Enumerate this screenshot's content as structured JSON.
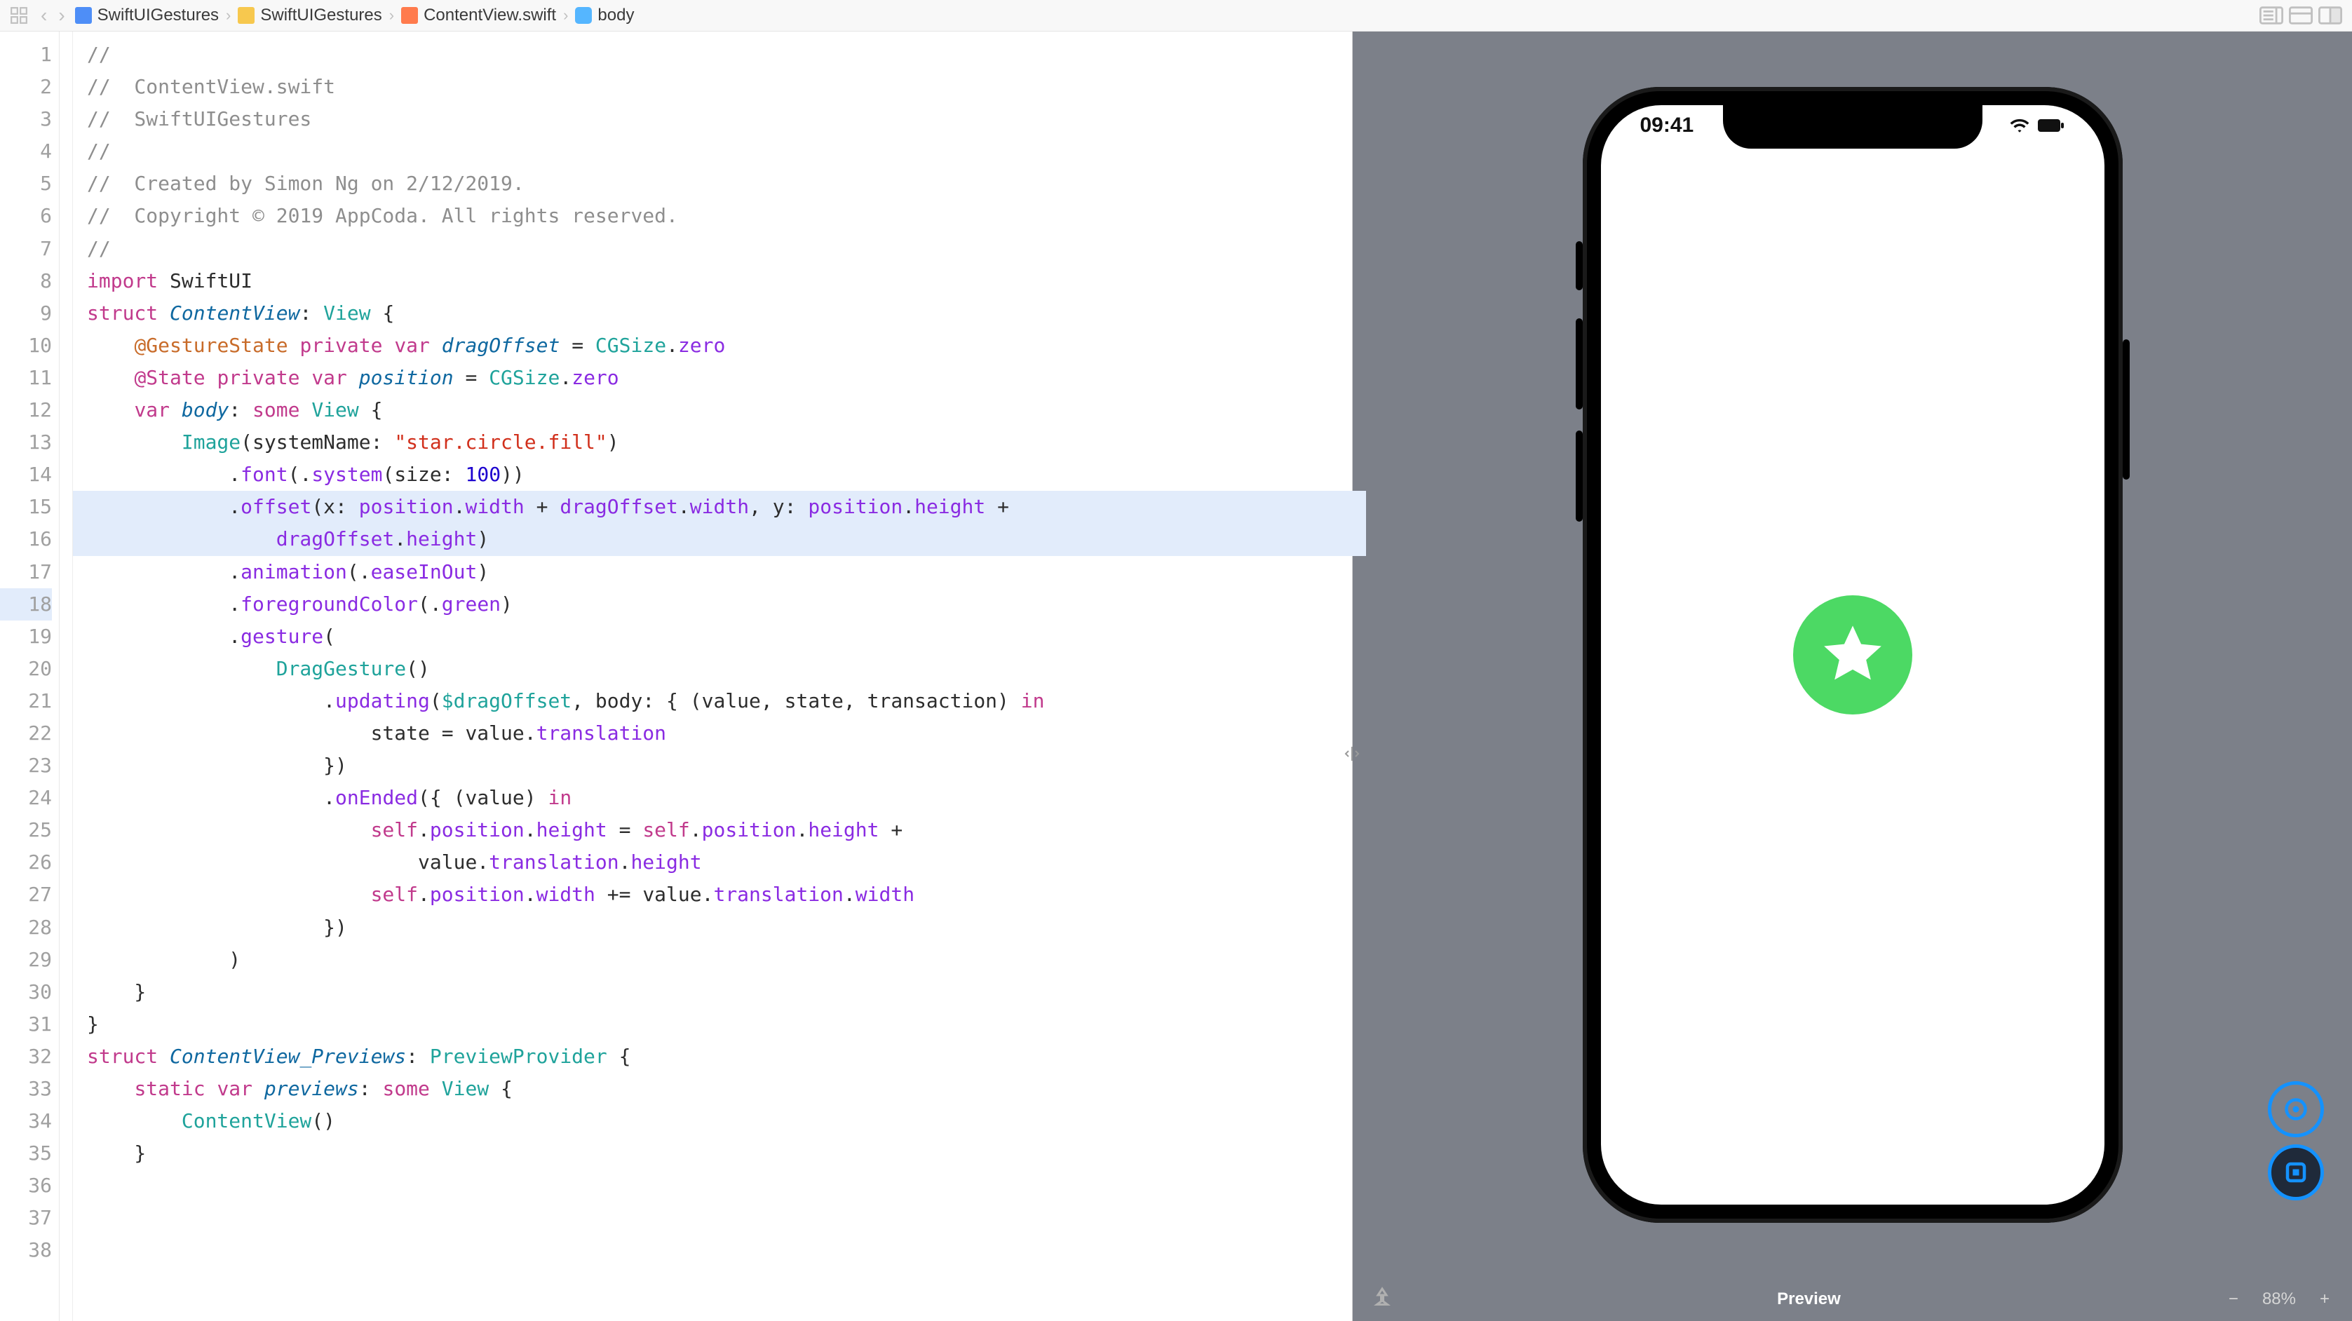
{
  "breadcrumb": {
    "project": "SwiftUIGestures",
    "group": "SwiftUIGestures",
    "file": "ContentView.swift",
    "symbol": "body"
  },
  "status_bar": {
    "time": "09:41",
    "wifi": "wifi",
    "battery": "battery-full"
  },
  "preview": {
    "label": "Preview",
    "zoom": "88%",
    "pinned": false
  },
  "code": {
    "highlighted_line": 18,
    "lines": [
      {
        "n": 1,
        "t": [
          {
            "s": "com",
            "x": "//"
          }
        ]
      },
      {
        "n": 2,
        "t": [
          {
            "s": "com",
            "x": "//  ContentView.swift"
          }
        ]
      },
      {
        "n": 3,
        "t": [
          {
            "s": "com",
            "x": "//  SwiftUIGestures"
          }
        ]
      },
      {
        "n": 4,
        "t": [
          {
            "s": "com",
            "x": "//"
          }
        ]
      },
      {
        "n": 5,
        "t": [
          {
            "s": "com",
            "x": "//  Created by Simon Ng on 2/12/2019."
          }
        ]
      },
      {
        "n": 6,
        "t": [
          {
            "s": "com",
            "x": "//  Copyright © 2019 AppCoda. All rights reserved."
          }
        ]
      },
      {
        "n": 7,
        "t": [
          {
            "s": "com",
            "x": "//"
          }
        ]
      },
      {
        "n": 8,
        "t": [
          {
            "s": "",
            "x": ""
          }
        ]
      },
      {
        "n": 9,
        "t": [
          {
            "s": "pink",
            "x": "import"
          },
          {
            "s": "",
            "x": " SwiftUI"
          }
        ]
      },
      {
        "n": 10,
        "t": [
          {
            "s": "",
            "x": ""
          }
        ]
      },
      {
        "n": 11,
        "t": [
          {
            "s": "pink",
            "x": "struct"
          },
          {
            "s": "",
            "x": " "
          },
          {
            "s": "blue",
            "x": "ContentView"
          },
          {
            "s": "",
            "x": ": "
          },
          {
            "s": "type",
            "x": "View"
          },
          {
            "s": "",
            "x": " {"
          }
        ]
      },
      {
        "n": 12,
        "t": [
          {
            "s": "",
            "x": "    "
          },
          {
            "s": "or",
            "x": "@GestureState"
          },
          {
            "s": "",
            "x": " "
          },
          {
            "s": "pink",
            "x": "private"
          },
          {
            "s": "",
            "x": " "
          },
          {
            "s": "pink",
            "x": "var"
          },
          {
            "s": "",
            "x": " "
          },
          {
            "s": "blue",
            "x": "dragOffset"
          },
          {
            "s": "",
            "x": " = "
          },
          {
            "s": "type",
            "x": "CGSize"
          },
          {
            "s": "",
            "x": "."
          },
          {
            "s": "pur",
            "x": "zero"
          }
        ]
      },
      {
        "n": 13,
        "t": [
          {
            "s": "",
            "x": "    "
          },
          {
            "s": "pink",
            "x": "@State"
          },
          {
            "s": "",
            "x": " "
          },
          {
            "s": "pink",
            "x": "private"
          },
          {
            "s": "",
            "x": " "
          },
          {
            "s": "pink",
            "x": "var"
          },
          {
            "s": "",
            "x": " "
          },
          {
            "s": "blue",
            "x": "position"
          },
          {
            "s": "",
            "x": " = "
          },
          {
            "s": "type",
            "x": "CGSize"
          },
          {
            "s": "",
            "x": "."
          },
          {
            "s": "pur",
            "x": "zero"
          }
        ]
      },
      {
        "n": 14,
        "t": [
          {
            "s": "",
            "x": ""
          }
        ]
      },
      {
        "n": 15,
        "t": [
          {
            "s": "",
            "x": "    "
          },
          {
            "s": "pink",
            "x": "var"
          },
          {
            "s": "",
            "x": " "
          },
          {
            "s": "blue",
            "x": "body"
          },
          {
            "s": "",
            "x": ": "
          },
          {
            "s": "pink",
            "x": "some"
          },
          {
            "s": "",
            "x": " "
          },
          {
            "s": "type",
            "x": "View"
          },
          {
            "s": "",
            "x": " {"
          }
        ]
      },
      {
        "n": 16,
        "t": [
          {
            "s": "",
            "x": "        "
          },
          {
            "s": "type",
            "x": "Image"
          },
          {
            "s": "",
            "x": "(systemName: "
          },
          {
            "s": "str",
            "x": "\"star.circle.fill\""
          },
          {
            "s": "",
            "x": ")"
          }
        ]
      },
      {
        "n": 17,
        "t": [
          {
            "s": "",
            "x": "            ."
          },
          {
            "s": "pur",
            "x": "font"
          },
          {
            "s": "",
            "x": "(."
          },
          {
            "s": "pur",
            "x": "system"
          },
          {
            "s": "",
            "x": "(size: "
          },
          {
            "s": "num",
            "x": "100"
          },
          {
            "s": "",
            "x": "))"
          }
        ]
      },
      {
        "n": 18,
        "hl": true,
        "t": [
          {
            "s": "",
            "x": "            ."
          },
          {
            "s": "pur",
            "x": "offset"
          },
          {
            "s": "",
            "x": "(x: "
          },
          {
            "s": "pur",
            "x": "position"
          },
          {
            "s": "",
            "x": "."
          },
          {
            "s": "pur",
            "x": "width"
          },
          {
            "s": "",
            "x": " + "
          },
          {
            "s": "pur",
            "x": "dragOffset"
          },
          {
            "s": "",
            "x": "."
          },
          {
            "s": "pur",
            "x": "width"
          },
          {
            "s": "",
            "x": ", y: "
          },
          {
            "s": "pur",
            "x": "position"
          },
          {
            "s": "",
            "x": "."
          },
          {
            "s": "pur",
            "x": "height"
          },
          {
            "s": "",
            "x": " + "
          }
        ]
      },
      {
        "n": 0,
        "hl": true,
        "t": [
          {
            "s": "",
            "x": "                "
          },
          {
            "s": "pur",
            "x": "dragOffset"
          },
          {
            "s": "",
            "x": "."
          },
          {
            "s": "pur",
            "x": "height"
          },
          {
            "s": "",
            "x": ")"
          }
        ]
      },
      {
        "n": 19,
        "t": [
          {
            "s": "",
            "x": "            ."
          },
          {
            "s": "pur",
            "x": "animation"
          },
          {
            "s": "",
            "x": "(."
          },
          {
            "s": "pur",
            "x": "easeInOut"
          },
          {
            "s": "",
            "x": ")"
          }
        ]
      },
      {
        "n": 20,
        "t": [
          {
            "s": "",
            "x": "            ."
          },
          {
            "s": "pur",
            "x": "foregroundColor"
          },
          {
            "s": "",
            "x": "(."
          },
          {
            "s": "pur",
            "x": "green"
          },
          {
            "s": "",
            "x": ")"
          }
        ]
      },
      {
        "n": 21,
        "t": [
          {
            "s": "",
            "x": "            ."
          },
          {
            "s": "pur",
            "x": "gesture"
          },
          {
            "s": "",
            "x": "("
          }
        ]
      },
      {
        "n": 22,
        "t": [
          {
            "s": "",
            "x": "                "
          },
          {
            "s": "type",
            "x": "DragGesture"
          },
          {
            "s": "",
            "x": "()"
          }
        ]
      },
      {
        "n": 23,
        "t": [
          {
            "s": "",
            "x": "                    ."
          },
          {
            "s": "pur",
            "x": "updating"
          },
          {
            "s": "",
            "x": "("
          },
          {
            "s": "type",
            "x": "$dragOffset"
          },
          {
            "s": "",
            "x": ", body: { (value, state, transaction) "
          },
          {
            "s": "pink",
            "x": "in"
          }
        ]
      },
      {
        "n": 24,
        "t": [
          {
            "s": "",
            "x": ""
          }
        ]
      },
      {
        "n": 25,
        "t": [
          {
            "s": "",
            "x": "                        state = value."
          },
          {
            "s": "pur",
            "x": "translation"
          }
        ]
      },
      {
        "n": 26,
        "t": [
          {
            "s": "",
            "x": "                    })"
          }
        ]
      },
      {
        "n": 27,
        "t": [
          {
            "s": "",
            "x": "                    ."
          },
          {
            "s": "pur",
            "x": "onEnded"
          },
          {
            "s": "",
            "x": "({ (value) "
          },
          {
            "s": "pink",
            "x": "in"
          }
        ]
      },
      {
        "n": 28,
        "t": [
          {
            "s": "",
            "x": "                        "
          },
          {
            "s": "pink",
            "x": "self"
          },
          {
            "s": "",
            "x": "."
          },
          {
            "s": "pur",
            "x": "position"
          },
          {
            "s": "",
            "x": "."
          },
          {
            "s": "pur",
            "x": "height"
          },
          {
            "s": "",
            "x": " = "
          },
          {
            "s": "pink",
            "x": "self"
          },
          {
            "s": "",
            "x": "."
          },
          {
            "s": "pur",
            "x": "position"
          },
          {
            "s": "",
            "x": "."
          },
          {
            "s": "pur",
            "x": "height"
          },
          {
            "s": "",
            "x": " + "
          }
        ]
      },
      {
        "n": 0,
        "t": [
          {
            "s": "",
            "x": "                            value."
          },
          {
            "s": "pur",
            "x": "translation"
          },
          {
            "s": "",
            "x": "."
          },
          {
            "s": "pur",
            "x": "height"
          }
        ]
      },
      {
        "n": 29,
        "t": [
          {
            "s": "",
            "x": "                        "
          },
          {
            "s": "pink",
            "x": "self"
          },
          {
            "s": "",
            "x": "."
          },
          {
            "s": "pur",
            "x": "position"
          },
          {
            "s": "",
            "x": "."
          },
          {
            "s": "pur",
            "x": "width"
          },
          {
            "s": "",
            "x": " += value."
          },
          {
            "s": "pur",
            "x": "translation"
          },
          {
            "s": "",
            "x": "."
          },
          {
            "s": "pur",
            "x": "width"
          }
        ]
      },
      {
        "n": 30,
        "t": [
          {
            "s": "",
            "x": "                    })"
          }
        ]
      },
      {
        "n": 31,
        "t": [
          {
            "s": "",
            "x": "            )"
          }
        ]
      },
      {
        "n": 32,
        "t": [
          {
            "s": "",
            "x": "    }"
          }
        ]
      },
      {
        "n": 33,
        "t": [
          {
            "s": "",
            "x": "}"
          }
        ]
      },
      {
        "n": 34,
        "t": [
          {
            "s": "",
            "x": ""
          }
        ]
      },
      {
        "n": 35,
        "t": [
          {
            "s": "pink",
            "x": "struct"
          },
          {
            "s": "",
            "x": " "
          },
          {
            "s": "blue",
            "x": "ContentView_Previews"
          },
          {
            "s": "",
            "x": ": "
          },
          {
            "s": "type",
            "x": "PreviewProvider"
          },
          {
            "s": "",
            "x": " {"
          }
        ]
      },
      {
        "n": 36,
        "t": [
          {
            "s": "",
            "x": "    "
          },
          {
            "s": "pink",
            "x": "static"
          },
          {
            "s": "",
            "x": " "
          },
          {
            "s": "pink",
            "x": "var"
          },
          {
            "s": "",
            "x": " "
          },
          {
            "s": "blue",
            "x": "previews"
          },
          {
            "s": "",
            "x": ": "
          },
          {
            "s": "pink",
            "x": "some"
          },
          {
            "s": "",
            "x": " "
          },
          {
            "s": "type",
            "x": "View"
          },
          {
            "s": "",
            "x": " {"
          }
        ]
      },
      {
        "n": 37,
        "t": [
          {
            "s": "",
            "x": "        "
          },
          {
            "s": "type",
            "x": "ContentView"
          },
          {
            "s": "",
            "x": "()"
          }
        ]
      },
      {
        "n": 38,
        "t": [
          {
            "s": "",
            "x": "    }"
          }
        ]
      }
    ]
  }
}
